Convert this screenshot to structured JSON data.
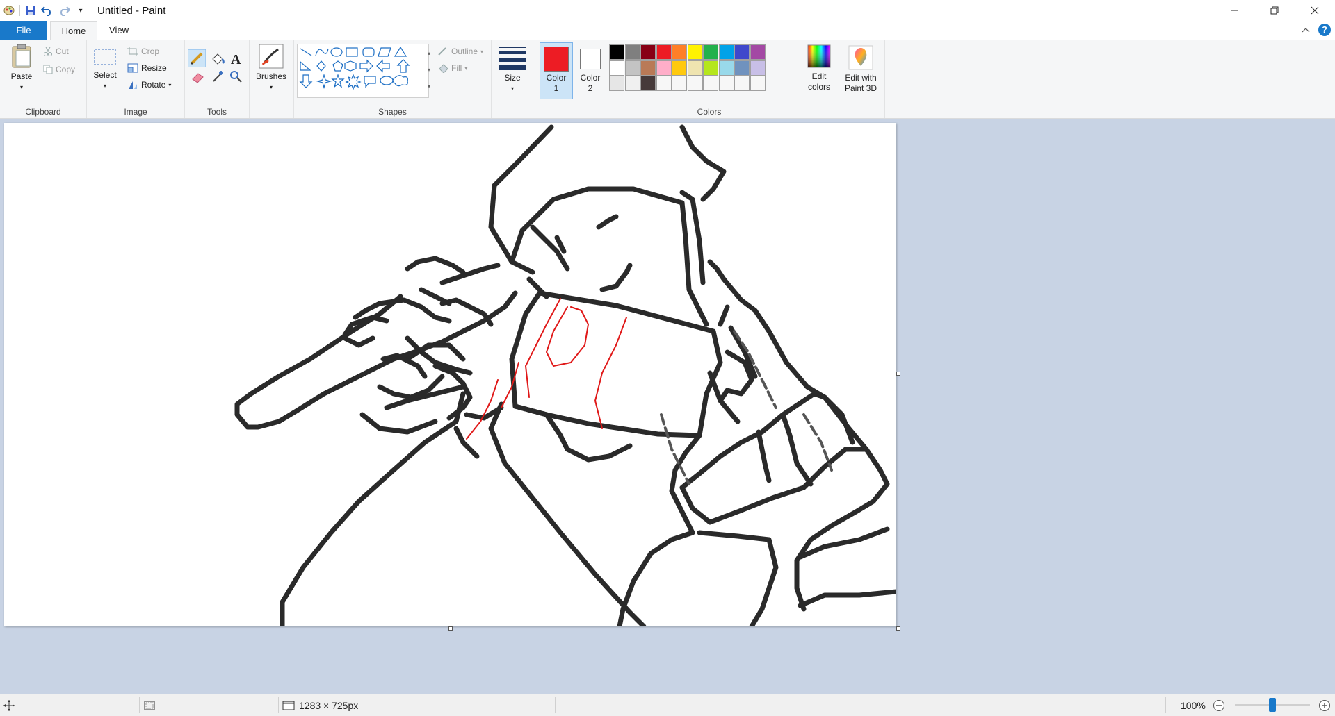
{
  "window": {
    "title": "Untitled - Paint"
  },
  "tabs": {
    "file": "File",
    "home": "Home",
    "view": "View"
  },
  "clipboard": {
    "paste": "Paste",
    "cut": "Cut",
    "copy": "Copy",
    "label": "Clipboard"
  },
  "image": {
    "select": "Select",
    "crop": "Crop",
    "resize": "Resize",
    "rotate": "Rotate",
    "label": "Image"
  },
  "tools": {
    "label": "Tools"
  },
  "brushes": {
    "label": "Brushes"
  },
  "shapes": {
    "outline": "Outline",
    "fill": "Fill",
    "label": "Shapes"
  },
  "size": {
    "label": "Size"
  },
  "colors": {
    "color1_label": "Color",
    "color1_num": "1",
    "color2_label": "Color",
    "color2_num": "2",
    "edit_colors_1": "Edit",
    "edit_colors_2": "colors",
    "edit_paint3d_1": "Edit with",
    "edit_paint3d_2": "Paint 3D",
    "label": "Colors",
    "color1_value": "#ed1c24",
    "color2_value": "#ffffff",
    "palette_row1": [
      "#000000",
      "#7f7f7f",
      "#880015",
      "#ed1c24",
      "#ff7f27",
      "#fff200",
      "#22b14c",
      "#00a2e8",
      "#3f48cc",
      "#a349a4"
    ],
    "palette_row2": [
      "#ffffff",
      "#c3c3c3",
      "#b97a57",
      "#ffaec9",
      "#ffc90e",
      "#efe4b0",
      "#b5e61d",
      "#99d9ea",
      "#7092be",
      "#c8bfe7"
    ],
    "palette_row3": [
      "#e6e6e6",
      "#f0f0f0",
      "#463a3a",
      "#f7f7f7",
      "#f7f7f7",
      "#f7f7f7",
      "#f7f7f7",
      "#f7f7f7",
      "#f7f7f7",
      "#f7f7f7"
    ]
  },
  "status": {
    "dimensions": "1283 × 725px",
    "zoom": "100%",
    "zoom_level": 0.5
  }
}
